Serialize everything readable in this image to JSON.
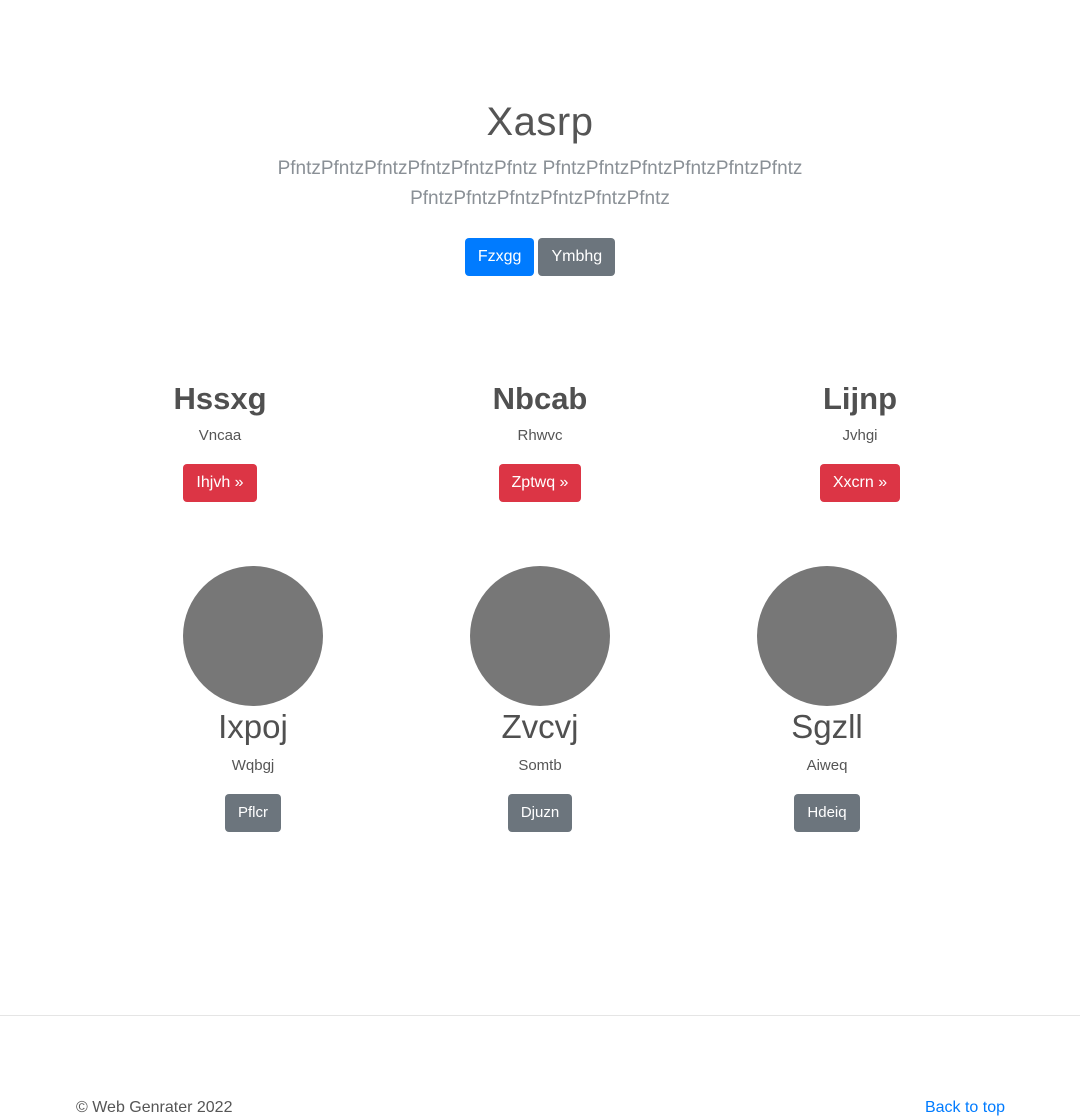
{
  "hero": {
    "title": "Xasrp",
    "lead": "PfntzPfntzPfntzPfntzPfntzPfntz PfntzPfntzPfntzPfntzPfntzPfntz PfntzPfntzPfntzPfntzPfntzPfntz",
    "primary_button": "Fzxgg",
    "secondary_button": "Ymbhg"
  },
  "features": [
    {
      "title": "Hssxg",
      "text": "Vncaa",
      "button": "Ihjvh »"
    },
    {
      "title": "Nbcab",
      "text": "Rhwvc",
      "button": "Zptwq »"
    },
    {
      "title": "Lijnp",
      "text": "Jvhgi",
      "button": "Xxcrn »"
    }
  ],
  "members": [
    {
      "name": "Ixpoj",
      "text": "Wqbgj",
      "button": "Pflcr"
    },
    {
      "name": "Zvcvj",
      "text": "Somtb",
      "button": "Djuzn"
    },
    {
      "name": "Sgzll",
      "text": "Aiweq",
      "button": "Hdeiq"
    }
  ],
  "footer": {
    "copyright": "© Web Genrater 2022",
    "back_to_top": "Back to top"
  },
  "colors": {
    "primary": "#007bff",
    "secondary": "#6c757d",
    "danger": "#dc3545",
    "avatar": "#777777"
  }
}
